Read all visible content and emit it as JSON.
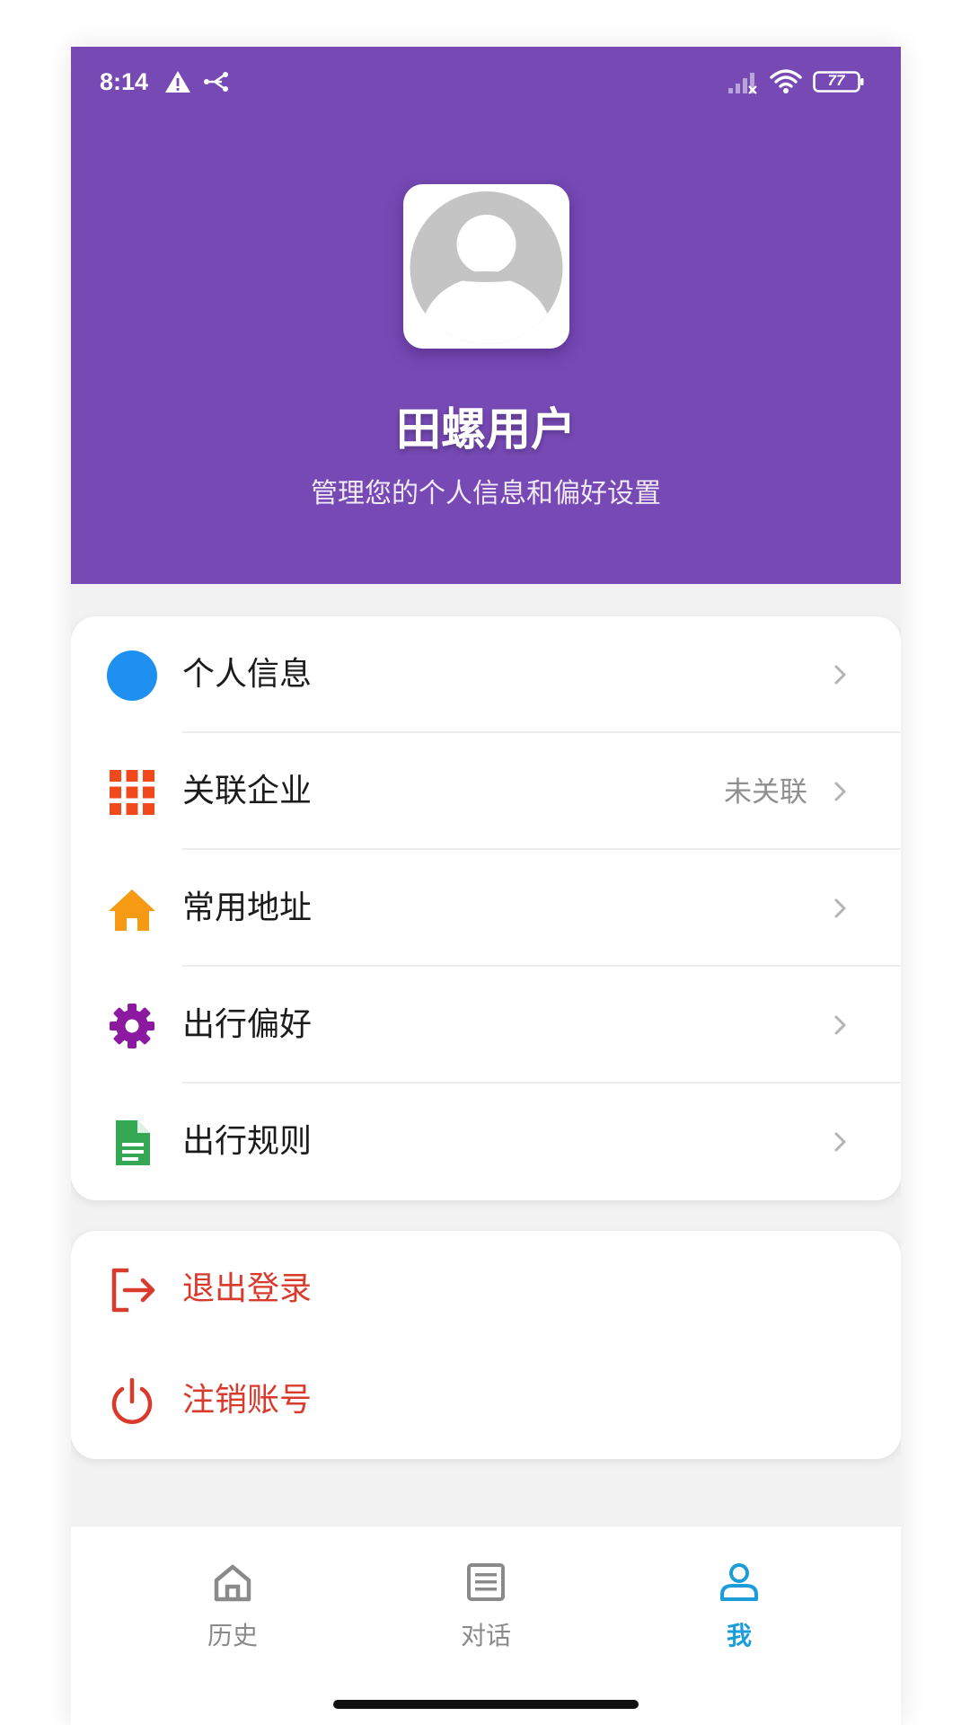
{
  "status_bar": {
    "time": "8:14",
    "battery": "77"
  },
  "profile": {
    "name": "田螺用户",
    "subtitle": "管理您的个人信息和偏好设置"
  },
  "menu": {
    "items": [
      {
        "label": "个人信息",
        "icon": "circle-icon",
        "value": ""
      },
      {
        "label": "关联企业",
        "icon": "grid-icon",
        "value": "未关联"
      },
      {
        "label": "常用地址",
        "icon": "home-icon",
        "value": ""
      },
      {
        "label": "出行偏好",
        "icon": "gear-icon",
        "value": ""
      },
      {
        "label": "出行规则",
        "icon": "document-icon",
        "value": ""
      }
    ]
  },
  "account": {
    "logout_label": "退出登录",
    "delete_label": "注销账号"
  },
  "bottom_nav": {
    "items": [
      {
        "label": "历史",
        "icon": "home-outline-icon",
        "active": false
      },
      {
        "label": "对话",
        "icon": "list-icon",
        "active": false
      },
      {
        "label": "我",
        "icon": "person-icon",
        "active": true
      }
    ]
  },
  "colors": {
    "header": "#7649b4",
    "accent_blue": "#1b9dd9",
    "danger": "#d93a2c",
    "info_icon": "#1e90f0",
    "grid_icon": "#f04a1c",
    "home_icon": "#f59a12",
    "gear_icon": "#8b1aa0",
    "doc_icon": "#34a853"
  }
}
